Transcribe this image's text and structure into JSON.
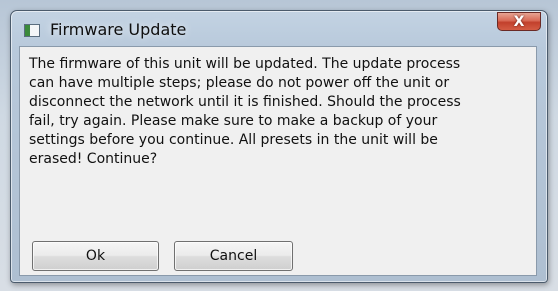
{
  "window": {
    "title": "Firmware Update",
    "close_glyph": "X"
  },
  "message": {
    "text": "The firmware of this unit will be updated. The update process\ncan have multiple steps; please do not power off the unit or\ndisconnect the network until it is finished. Should the process\nfail, try again. Please make sure to make a backup of your\nsettings before you continue. All presets in the unit will be\nerased! Continue?"
  },
  "buttons": {
    "ok_label": "Ok",
    "cancel_label": "Cancel"
  },
  "icons": {
    "app": "window-app-icon",
    "close": "close-icon"
  },
  "colors": {
    "close_button": "#c2402c",
    "dialog_background": "#f0f0f0",
    "window_frame": "#b8c9db"
  }
}
